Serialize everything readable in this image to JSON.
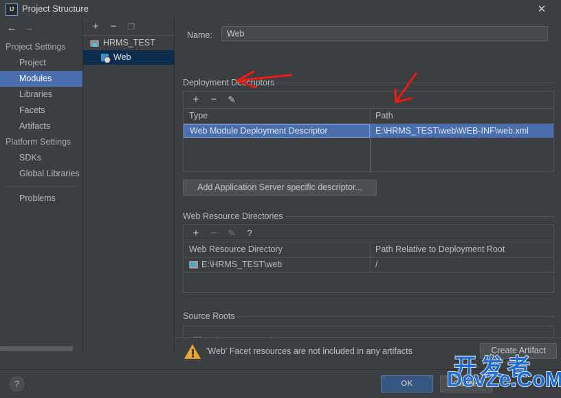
{
  "window": {
    "title": "Project Structure",
    "app_icon": "IJ",
    "close_icon": "✕"
  },
  "nav": {
    "back_icon": "←",
    "forward_icon": "→"
  },
  "sidebar": {
    "groups": [
      {
        "label": "Project Settings",
        "items": [
          {
            "label": "Project",
            "selected": false
          },
          {
            "label": "Modules",
            "selected": true
          },
          {
            "label": "Libraries",
            "selected": false
          },
          {
            "label": "Facets",
            "selected": false
          },
          {
            "label": "Artifacts",
            "selected": false
          }
        ]
      },
      {
        "label": "Platform Settings",
        "items": [
          {
            "label": "SDKs",
            "selected": false
          },
          {
            "label": "Global Libraries",
            "selected": false
          }
        ]
      }
    ],
    "problems_label": "Problems"
  },
  "tree": {
    "toolbar": {
      "add_icon": "+",
      "remove_icon": "−",
      "copy_icon": "❐"
    },
    "rows": [
      {
        "label": "HRMS_TEST",
        "icon": "module-icon",
        "selected": false,
        "indent": 12
      },
      {
        "label": "Web",
        "icon": "web-facet-icon",
        "selected": true,
        "indent": 30
      }
    ]
  },
  "main": {
    "name_label": "Name:",
    "name_value": "Web",
    "deployment": {
      "section_title": "Deployment Descriptors",
      "toolbar": {
        "add_icon": "+",
        "remove_icon": "−",
        "edit_icon": "✎"
      },
      "columns": [
        "Type",
        "Path"
      ],
      "rows": [
        {
          "type": "Web Module Deployment Descriptor",
          "path": "E:\\HRMS_TEST\\web\\WEB-INF\\web.xml",
          "selected": true
        }
      ],
      "add_descriptor_button": "Add Application Server specific descriptor..."
    },
    "web_resources": {
      "section_title": "Web Resource Directories",
      "toolbar": {
        "add_icon": "+",
        "remove_icon": "−",
        "edit_icon": "✎",
        "help_icon": "?"
      },
      "columns": [
        "Web Resource Directory",
        "Path Relative to Deployment Root"
      ],
      "rows": [
        {
          "directory": "E:\\HRMS_TEST\\web",
          "relative_path": "/"
        }
      ]
    },
    "source_roots": {
      "section_title": "Source Roots",
      "rows": [
        {
          "path": "E:\\HRMS_TEST\\src",
          "checked": true
        }
      ]
    },
    "warning": {
      "text": "'Web' Facet resources are not included in any artifacts",
      "icon": "warning-triangle-icon",
      "action_button": "Create Artifact"
    }
  },
  "footer": {
    "help_icon": "?",
    "ok_label": "OK",
    "cancel_label": "Cancel"
  },
  "watermark": {
    "line1": "开发者",
    "line2": "DevZe.CoM",
    "color": "#1f6fd0"
  },
  "annotations": {
    "arrow_color": "#e81b16",
    "arrow_1_target": "edit-descriptor-button",
    "arrow_2_target": "path-column-header"
  }
}
